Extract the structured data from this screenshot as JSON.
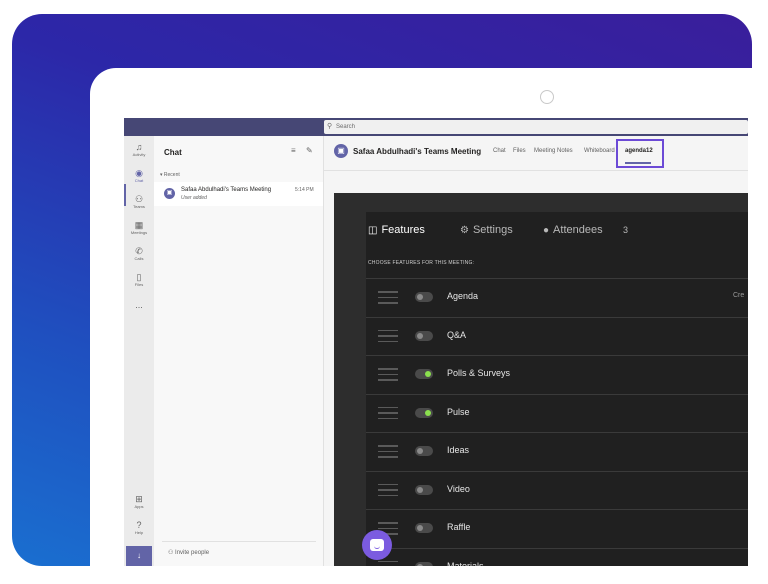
{
  "search": {
    "placeholder": "Search"
  },
  "rail": {
    "items": [
      {
        "label": "Activity",
        "icon": "bell-icon"
      },
      {
        "label": "Chat",
        "icon": "chat-icon"
      },
      {
        "label": "Teams",
        "icon": "teams-icon"
      },
      {
        "label": "Meetings",
        "icon": "calendar-icon"
      },
      {
        "label": "Calls",
        "icon": "phone-icon"
      },
      {
        "label": "Files",
        "icon": "file-icon"
      },
      {
        "label": "...",
        "icon": "more-icon"
      },
      {
        "label": "Apps",
        "icon": "apps-icon"
      },
      {
        "label": "Help",
        "icon": "help-icon"
      }
    ]
  },
  "chat": {
    "title": "Chat",
    "section": "Recent",
    "items": [
      {
        "name": "Safaa Abdulhadi's Teams Meeting",
        "subtitle": "User added",
        "time": "5:14 PM"
      }
    ],
    "invite": "Invite people"
  },
  "meeting": {
    "title": "Safaa Abdulhadi's Teams Meeting",
    "tabs": [
      "Chat",
      "Files",
      "Meeting Notes",
      "Whiteboard",
      "agenda12"
    ],
    "active_tab": "agenda12"
  },
  "panel": {
    "tabs": [
      {
        "label": "Features",
        "icon": "features-icon"
      },
      {
        "label": "Settings",
        "icon": "gear-icon"
      },
      {
        "label": "Attendees",
        "icon": "person-icon"
      }
    ],
    "attendee_count": "3",
    "heading": "CHOOSE FEATURES FOR THIS MEETING:",
    "features": [
      {
        "name": "Agenda",
        "enabled": false,
        "extra": "Cre"
      },
      {
        "name": "Q&A",
        "enabled": false,
        "extra": ""
      },
      {
        "name": "Polls & Surveys",
        "enabled": true,
        "extra": ""
      },
      {
        "name": "Pulse",
        "enabled": true,
        "extra": ""
      },
      {
        "name": "Ideas",
        "enabled": false,
        "extra": ""
      },
      {
        "name": "Video",
        "enabled": false,
        "extra": ""
      },
      {
        "name": "Raffle",
        "enabled": false,
        "extra": ""
      },
      {
        "name": "Materials",
        "enabled": false,
        "extra": ""
      }
    ]
  },
  "colors": {
    "accent": "#6264a7",
    "highlight": "#6c4ad6",
    "toggle_on": "#8be04e",
    "gradient_top": "#3a1e9b",
    "gradient_bottom": "#1a6fd0"
  }
}
